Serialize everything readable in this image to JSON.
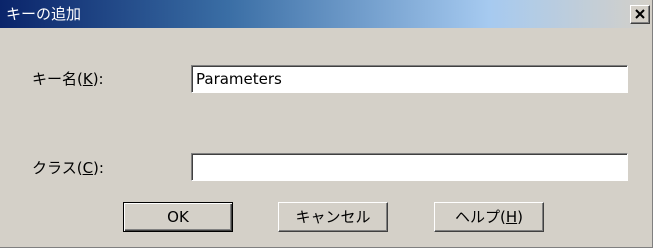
{
  "window": {
    "title": "キーの追加"
  },
  "icons": {
    "close": "close-icon"
  },
  "form": {
    "key_name": {
      "label_prefix": "キー名(",
      "mnemonic": "K",
      "label_suffix": "):",
      "value": "Parameters"
    },
    "class": {
      "label_prefix": "クラス(",
      "mnemonic": "C",
      "label_suffix": "):",
      "value": ""
    }
  },
  "buttons": {
    "ok": "OK",
    "cancel": "キャンセル",
    "help_prefix": "ヘルプ(",
    "help_mnemonic": "H",
    "help_suffix": ")"
  },
  "colors": {
    "title_gradient_start": "#0a246a",
    "title_gradient_end": "#d4d0c8",
    "face": "#d4d0c8"
  }
}
